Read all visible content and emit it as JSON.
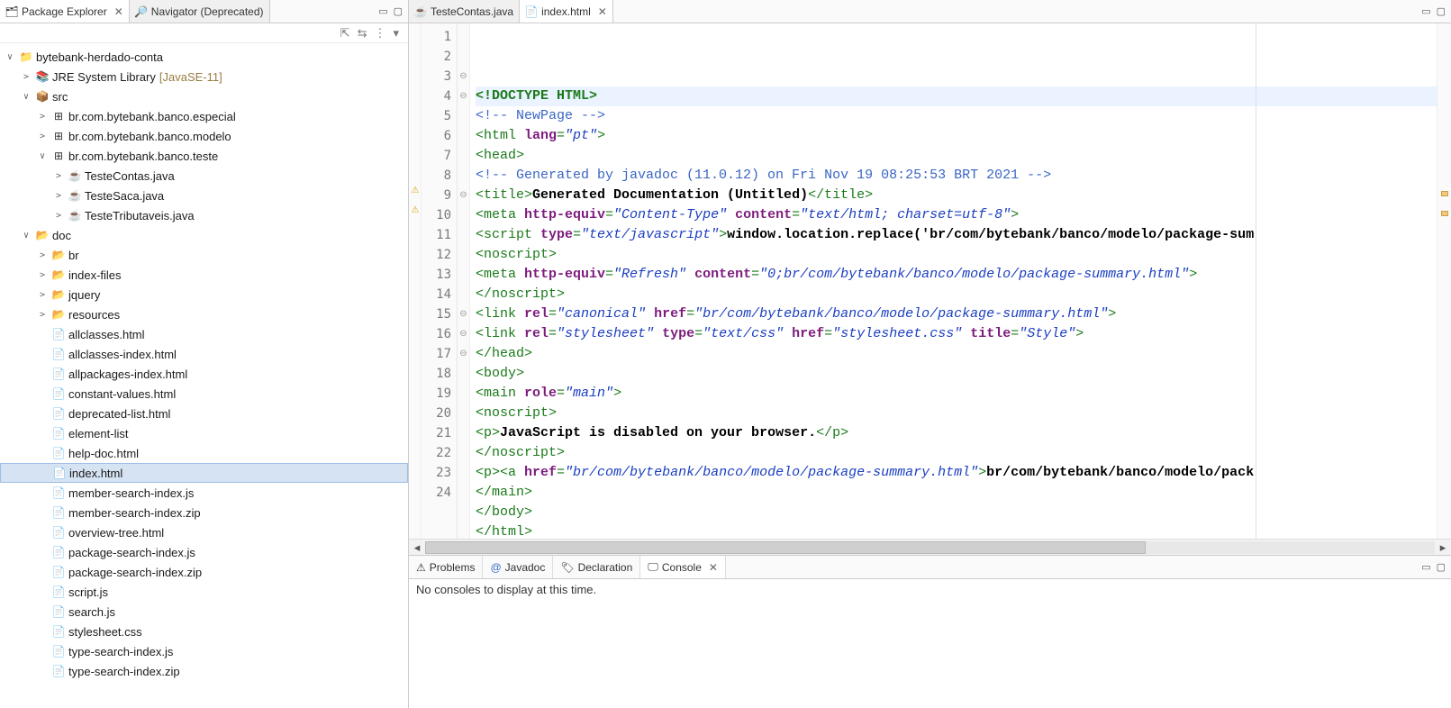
{
  "left_tabs": {
    "package_explorer": "Package Explorer",
    "navigator": "Navigator (Deprecated)"
  },
  "tree": {
    "project": "bytebank-herdado-conta",
    "jre": "JRE System Library",
    "jre_decor": "[JavaSE-11]",
    "src": "src",
    "pkg_especial": "br.com.bytebank.banco.especial",
    "pkg_modelo": "br.com.bytebank.banco.modelo",
    "pkg_teste": "br.com.bytebank.banco.teste",
    "cu_contas": "TesteContas.java",
    "cu_saca": "TesteSaca.java",
    "cu_trib": "TesteTributaveis.java",
    "doc": "doc",
    "doc_br": "br",
    "doc_indexfiles": "index-files",
    "doc_jquery": "jquery",
    "doc_resources": "resources",
    "files": [
      "allclasses.html",
      "allclasses-index.html",
      "allpackages-index.html",
      "constant-values.html",
      "deprecated-list.html",
      "element-list",
      "help-doc.html",
      "index.html",
      "member-search-index.js",
      "member-search-index.zip",
      "overview-tree.html",
      "package-search-index.js",
      "package-search-index.zip",
      "script.js",
      "search.js",
      "stylesheet.css",
      "type-search-index.js",
      "type-search-index.zip"
    ]
  },
  "editor_tabs": {
    "teste": "TesteContas.java",
    "index": "index.html"
  },
  "code_lines": [
    {
      "n": "1",
      "seg": [
        {
          "c": "t-spec",
          "t": "<!DOCTYPE HTML>"
        }
      ]
    },
    {
      "n": "2",
      "seg": [
        {
          "c": "t-com",
          "t": "<!-- NewPage -->"
        }
      ]
    },
    {
      "n": "3",
      "seg": [
        {
          "c": "t-tag",
          "t": "<html "
        },
        {
          "c": "t-attr",
          "t": "lang"
        },
        {
          "c": "t-tag",
          "t": "="
        },
        {
          "c": "t-str",
          "t": "\"pt\""
        },
        {
          "c": "t-tag",
          "t": ">"
        }
      ]
    },
    {
      "n": "4",
      "seg": [
        {
          "c": "t-tag",
          "t": "<head>"
        }
      ]
    },
    {
      "n": "5",
      "seg": [
        {
          "c": "t-com",
          "t": "<!-- Generated by javadoc (11.0.12) on Fri Nov 19 08:25:53 BRT 2021 -->"
        }
      ]
    },
    {
      "n": "6",
      "seg": [
        {
          "c": "t-tag",
          "t": "<title>"
        },
        {
          "c": "t-txt",
          "t": "Generated Documentation (Untitled)"
        },
        {
          "c": "t-tag",
          "t": "</title>"
        }
      ]
    },
    {
      "n": "7",
      "seg": [
        {
          "c": "t-tag",
          "t": "<meta "
        },
        {
          "c": "t-attr",
          "t": "http-equiv"
        },
        {
          "c": "t-tag",
          "t": "="
        },
        {
          "c": "t-str",
          "t": "\"Content-Type\""
        },
        {
          "c": "t-tag",
          "t": " "
        },
        {
          "c": "t-attr",
          "t": "content"
        },
        {
          "c": "t-tag",
          "t": "="
        },
        {
          "c": "t-str",
          "t": "\"text/html; charset=utf-8\""
        },
        {
          "c": "t-tag",
          "t": ">"
        }
      ]
    },
    {
      "n": "8",
      "seg": [
        {
          "c": "t-tag",
          "t": "<script "
        },
        {
          "c": "t-attr",
          "t": "type"
        },
        {
          "c": "t-tag",
          "t": "="
        },
        {
          "c": "t-str",
          "t": "\"text/javascript\""
        },
        {
          "c": "t-tag",
          "t": ">"
        },
        {
          "c": "t-txt",
          "t": "window.location.replace('br/com/bytebank/banco/modelo/package-sum"
        }
      ]
    },
    {
      "n": "9",
      "seg": [
        {
          "c": "t-tag",
          "t": "<noscript>"
        }
      ]
    },
    {
      "n": "10",
      "seg": [
        {
          "c": "t-tag",
          "t": "<meta "
        },
        {
          "c": "t-attr",
          "t": "http-equiv"
        },
        {
          "c": "t-tag",
          "t": "="
        },
        {
          "c": "t-str",
          "t": "\"Refresh\""
        },
        {
          "c": "t-tag",
          "t": " "
        },
        {
          "c": "t-attr",
          "t": "content"
        },
        {
          "c": "t-tag",
          "t": "="
        },
        {
          "c": "t-str",
          "t": "\"0;br/com/bytebank/banco/modelo/package-summary.html\""
        },
        {
          "c": "t-tag",
          "t": ">"
        }
      ]
    },
    {
      "n": "11",
      "seg": [
        {
          "c": "t-tag",
          "t": "</noscript>"
        }
      ]
    },
    {
      "n": "12",
      "seg": [
        {
          "c": "t-tag",
          "t": "<link "
        },
        {
          "c": "t-attr",
          "t": "rel"
        },
        {
          "c": "t-tag",
          "t": "="
        },
        {
          "c": "t-str",
          "t": "\"canonical\""
        },
        {
          "c": "t-tag",
          "t": " "
        },
        {
          "c": "t-attr",
          "t": "href"
        },
        {
          "c": "t-tag",
          "t": "="
        },
        {
          "c": "t-str",
          "t": "\"br/com/bytebank/banco/modelo/package-summary.html\""
        },
        {
          "c": "t-tag",
          "t": ">"
        }
      ]
    },
    {
      "n": "13",
      "seg": [
        {
          "c": "t-tag",
          "t": "<link "
        },
        {
          "c": "t-attr",
          "t": "rel"
        },
        {
          "c": "t-tag",
          "t": "="
        },
        {
          "c": "t-str",
          "t": "\"stylesheet\""
        },
        {
          "c": "t-tag",
          "t": " "
        },
        {
          "c": "t-attr",
          "t": "type"
        },
        {
          "c": "t-tag",
          "t": "="
        },
        {
          "c": "t-str",
          "t": "\"text/css\""
        },
        {
          "c": "t-tag",
          "t": " "
        },
        {
          "c": "t-attr",
          "t": "href"
        },
        {
          "c": "t-tag",
          "t": "="
        },
        {
          "c": "t-str",
          "t": "\"stylesheet.css\""
        },
        {
          "c": "t-tag",
          "t": " "
        },
        {
          "c": "t-attr",
          "t": "title"
        },
        {
          "c": "t-tag",
          "t": "="
        },
        {
          "c": "t-str",
          "t": "\"Style\""
        },
        {
          "c": "t-tag",
          "t": ">"
        }
      ]
    },
    {
      "n": "14",
      "seg": [
        {
          "c": "t-tag",
          "t": "</head>"
        }
      ]
    },
    {
      "n": "15",
      "seg": [
        {
          "c": "t-tag",
          "t": "<body>"
        }
      ]
    },
    {
      "n": "16",
      "seg": [
        {
          "c": "t-tag",
          "t": "<main "
        },
        {
          "c": "t-attr",
          "t": "role"
        },
        {
          "c": "t-tag",
          "t": "="
        },
        {
          "c": "t-str",
          "t": "\"main\""
        },
        {
          "c": "t-tag",
          "t": ">"
        }
      ]
    },
    {
      "n": "17",
      "seg": [
        {
          "c": "t-tag",
          "t": "<noscript>"
        }
      ]
    },
    {
      "n": "18",
      "seg": [
        {
          "c": "t-tag",
          "t": "<p>"
        },
        {
          "c": "t-txt",
          "t": "JavaScript is disabled on your browser."
        },
        {
          "c": "t-tag",
          "t": "</p>"
        }
      ]
    },
    {
      "n": "19",
      "seg": [
        {
          "c": "t-tag",
          "t": "</noscript>"
        }
      ]
    },
    {
      "n": "20",
      "seg": [
        {
          "c": "t-tag",
          "t": "<p><a "
        },
        {
          "c": "t-attr",
          "t": "href"
        },
        {
          "c": "t-tag",
          "t": "="
        },
        {
          "c": "t-str",
          "t": "\"br/com/bytebank/banco/modelo/package-summary.html\""
        },
        {
          "c": "t-tag",
          "t": ">"
        },
        {
          "c": "t-txt",
          "t": "br/com/bytebank/banco/modelo/pack"
        }
      ]
    },
    {
      "n": "21",
      "seg": [
        {
          "c": "t-tag",
          "t": "</main>"
        }
      ]
    },
    {
      "n": "22",
      "seg": [
        {
          "c": "t-tag",
          "t": "</body>"
        }
      ]
    },
    {
      "n": "23",
      "seg": [
        {
          "c": "t-tag",
          "t": "</html>"
        }
      ]
    },
    {
      "n": "24",
      "seg": [
        {
          "c": "",
          "t": ""
        }
      ]
    }
  ],
  "fold_marks": {
    "3": "⊖",
    "4": "⊖",
    "9": "⊖",
    "15": "⊖",
    "16": "⊖",
    "17": "⊖"
  },
  "warn_lines": [
    "9",
    "10"
  ],
  "bottom_tabs": {
    "problems": "Problems",
    "javadoc": "Javadoc",
    "declaration": "Declaration",
    "console": "Console"
  },
  "console_body": "No consoles to display at this time."
}
